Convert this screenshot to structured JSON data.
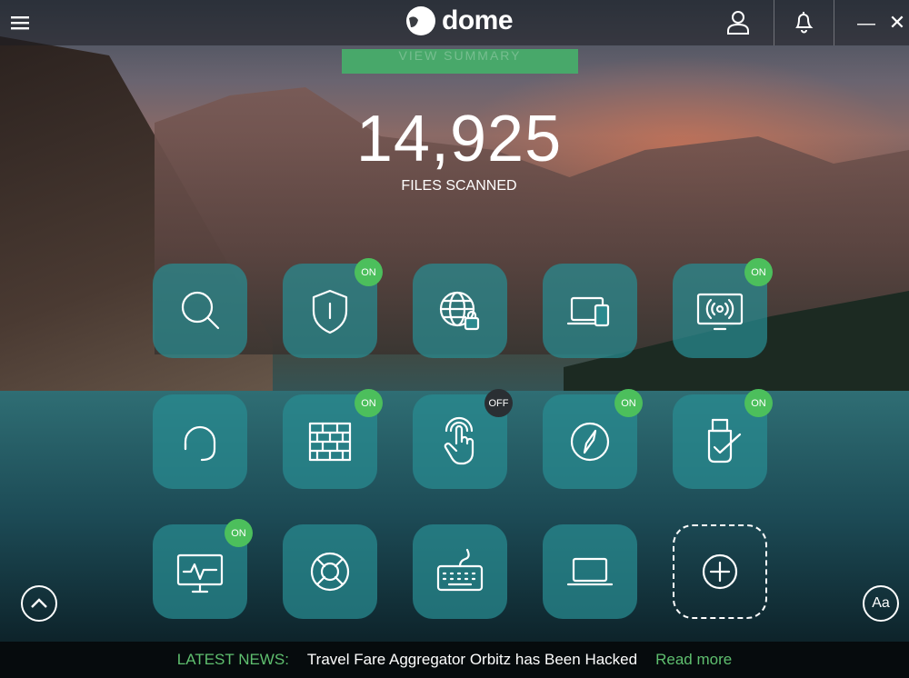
{
  "header": {
    "logo_text": "dome",
    "menu_icon": "hamburger-icon",
    "user_icon": "user-icon",
    "bell_icon": "bell-icon",
    "minimize_label": "—",
    "close_label": "✕"
  },
  "summary_button": {
    "label": "VIEW SUMMARY"
  },
  "scan": {
    "count": "14,925",
    "label": "FILES SCANNED"
  },
  "tiles": [
    {
      "icon": "search-icon"
    },
    {
      "icon": "shield-icon",
      "status": "ON"
    },
    {
      "icon": "globe-lock-icon"
    },
    {
      "icon": "devices-icon"
    },
    {
      "icon": "wifi-monitor-icon",
      "status": "ON"
    },
    {
      "icon": "headset-icon"
    },
    {
      "icon": "firewall-icon",
      "status": "ON"
    },
    {
      "icon": "touch-icon",
      "status": "OFF"
    },
    {
      "icon": "compass-icon",
      "status": "ON"
    },
    {
      "icon": "usb-icon",
      "status": "ON"
    },
    {
      "icon": "monitor-pulse-icon",
      "status": "ON"
    },
    {
      "icon": "lifebuoy-icon"
    },
    {
      "icon": "keyboard-icon"
    },
    {
      "icon": "laptop-icon"
    },
    {
      "icon": "add-icon"
    }
  ],
  "footer": {
    "scroll_up_icon": "chevron-up-icon",
    "font_button": "Aa"
  },
  "news": {
    "label": "LATEST NEWS:",
    "headline": "Travel Fare Aggregator Orbitz has Been Hacked",
    "link": "Read more"
  },
  "colors": {
    "accent_green": "#4cbf5c",
    "tile": "#288c91",
    "news_green": "#5fbf6f"
  }
}
